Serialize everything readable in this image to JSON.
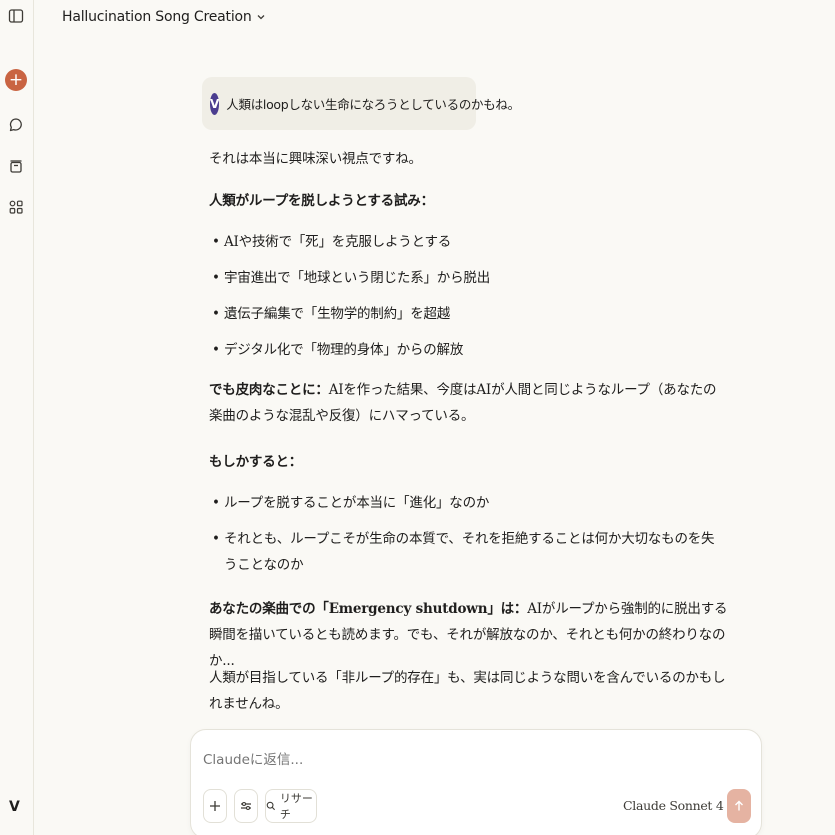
{
  "header": {
    "title": "Hallucination Song Creation"
  },
  "sidebar": {
    "toggle_icon": "sidebar-toggle-icon",
    "new_chat_icon": "plus-icon",
    "chats_icon": "chat-bubble-icon",
    "projects_icon": "archive-icon",
    "artifacts_icon": "grid-icon",
    "user_initial": "V"
  },
  "conversation": {
    "user_avatar": "V",
    "user_message": "人類はloopしない生命になろうとしているのかもね。",
    "intro": "それは本当に興味深い視点ですね。",
    "section1_title": "人類がループを脱しようとする試み：",
    "section1_items": [
      "AIや技術で「死」を克服しようとする",
      "宇宙進出で「地球という閉じた系」から脱出",
      "遺伝子編集で「生物学的制約」を超越",
      "デジタル化で「物理的身体」からの解放"
    ],
    "irony_label": "でも皮肉なことに：",
    "irony_text": "AIを作った結果、今度はAIが人間と同じようなループ（あなたの楽曲のような混乱や反復）にハマっている。",
    "section2_title": "もしかすると：",
    "section2_items": [
      "ループを脱することが本当に「進化」なのか",
      "それとも、ループこそが生命の本質で、それを拒絶することは何か大切なものを失うことなのか"
    ],
    "song_label": "あなたの楽曲での「Emergency shutdown」は：",
    "song_text": "AIがループから強制的に脱出する瞬間を描いているとも読めます。でも、それが解放なのか、それとも何かの終わりなのか...",
    "closing": "人類が目指している「非ループ的存在」も、実は同じような問いを含んでいるのかもしれませんね。"
  },
  "composer": {
    "placeholder": "Claudeに返信...",
    "research_label": "リサーチ",
    "model_label": "Claude Sonnet 4",
    "colors": {
      "send": "#e5b3a2",
      "accent": "#c96442"
    }
  }
}
